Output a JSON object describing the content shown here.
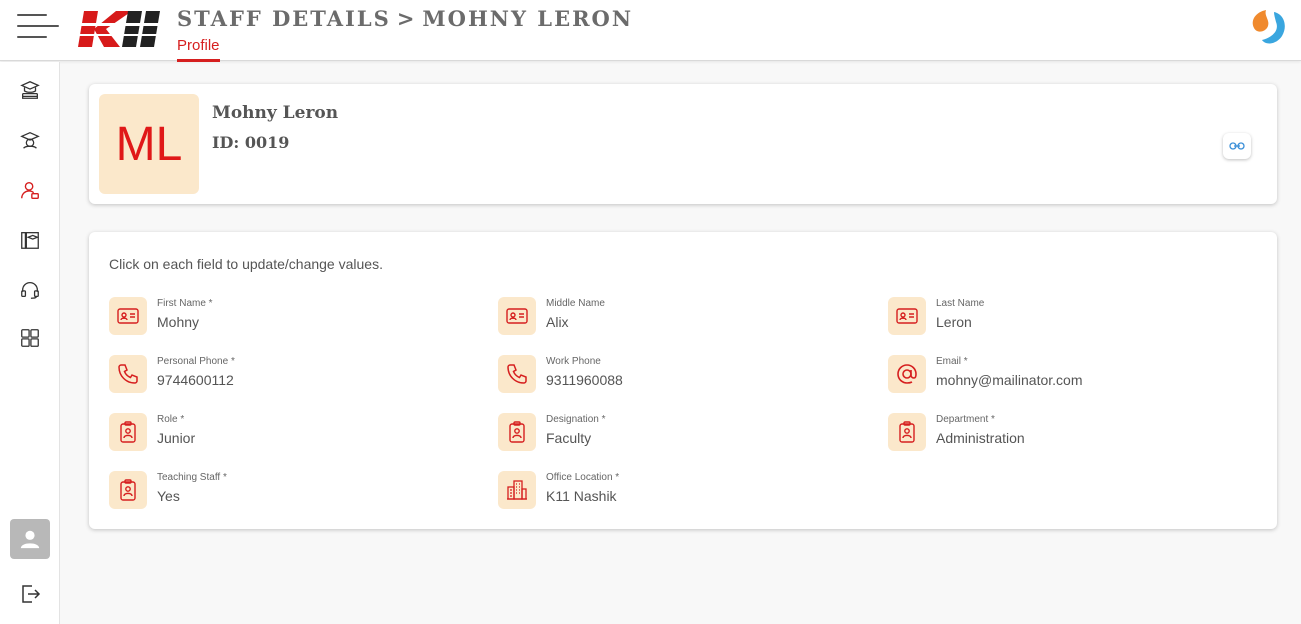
{
  "header": {
    "title_section": "STAFF DETAILS",
    "title_separator": ">",
    "title_name": "MOHNY LERON",
    "active_tab": "Profile"
  },
  "profile": {
    "initials": "ML",
    "name": "Mohny Leron",
    "id_text": "ID: 0019"
  },
  "details": {
    "hint": "Click on each field to update/change values.",
    "fields": [
      {
        "label": "First Name *",
        "value": "Mohny",
        "icon": "id-card-icon"
      },
      {
        "label": "Middle Name",
        "value": "Alix",
        "icon": "id-card-icon"
      },
      {
        "label": "Last Name",
        "value": "Leron",
        "icon": "id-card-icon"
      },
      {
        "label": "Personal Phone *",
        "value": "9744600112",
        "icon": "phone-icon"
      },
      {
        "label": "Work Phone",
        "value": "9311960088",
        "icon": "phone-icon"
      },
      {
        "label": "Email *",
        "value": "mohny@mailinator.com",
        "icon": "at-sign-icon"
      },
      {
        "label": "Role *",
        "value": "Junior",
        "icon": "badge-icon"
      },
      {
        "label": "Designation *",
        "value": "Faculty",
        "icon": "badge-icon"
      },
      {
        "label": "Department *",
        "value": "Administration",
        "icon": "badge-icon"
      },
      {
        "label": "Teaching Staff *",
        "value": "Yes",
        "icon": "badge-icon"
      },
      {
        "label": "Office Location *",
        "value": "K11 Nashik",
        "icon": "buildings-icon"
      }
    ]
  },
  "colors": {
    "accent": "#d61f1f",
    "icon_bg": "#fbe8cb",
    "text_muted": "#555555"
  }
}
